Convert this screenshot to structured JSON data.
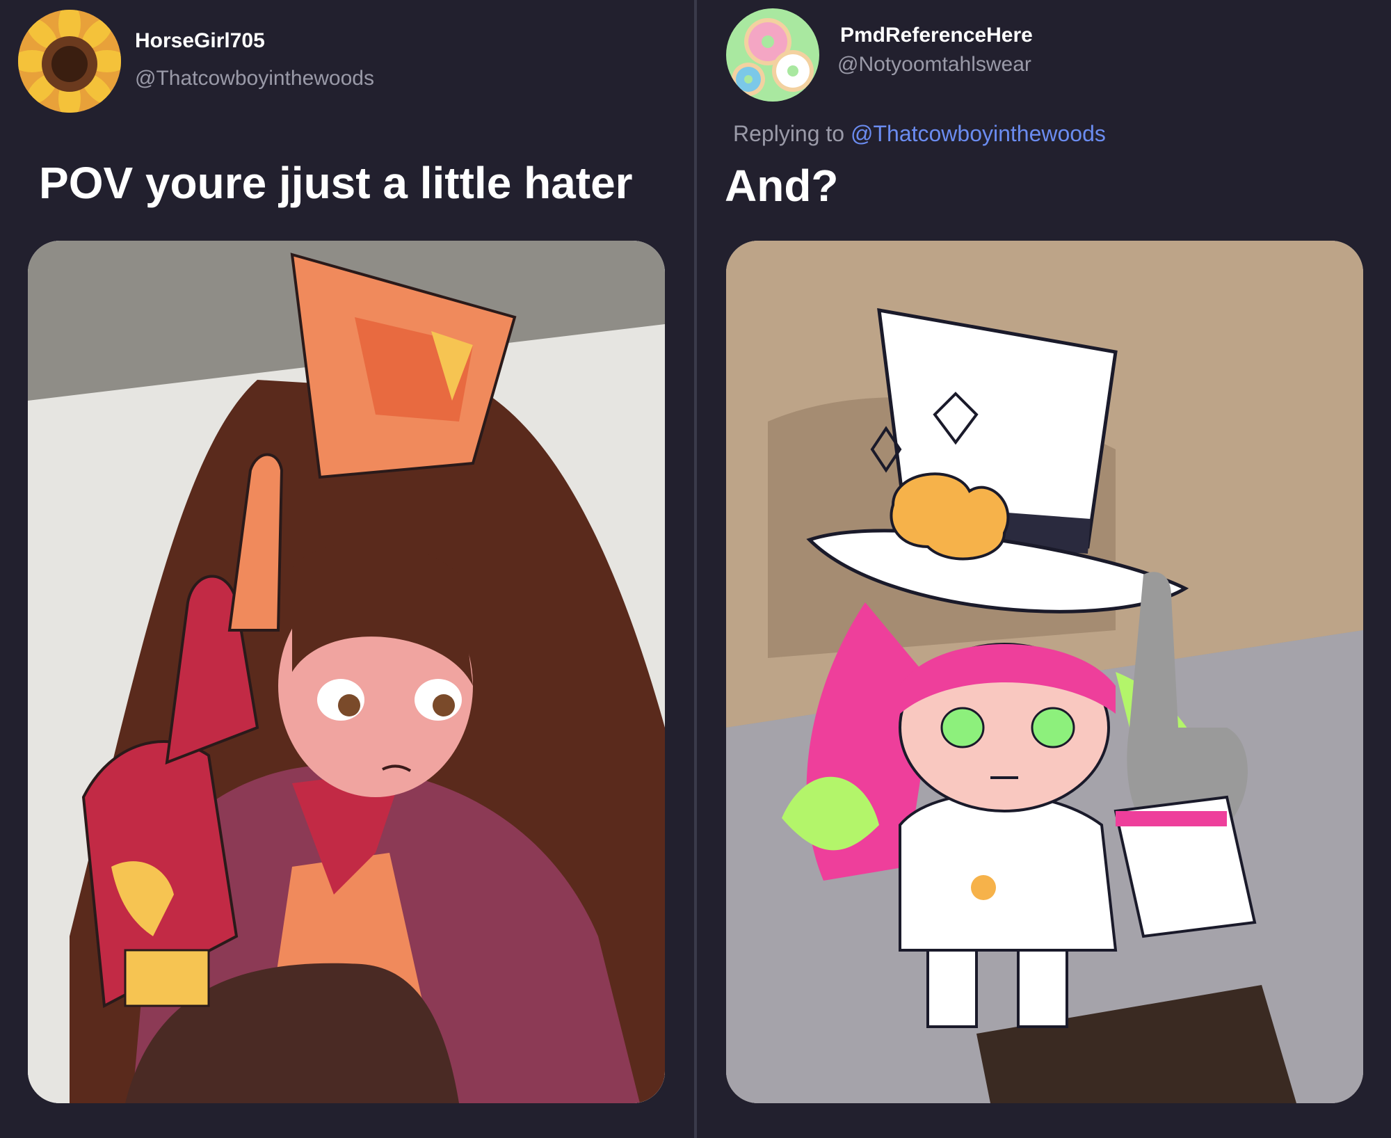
{
  "left_tweet": {
    "display_name": "HorseGirl705",
    "handle": "@Thatcowboyinthewoods",
    "text": "POV youre jjust a little hater",
    "avatar_icon": "sunflower-avatar",
    "media_icon": "cowgirl-illustration-image"
  },
  "right_tweet": {
    "display_name": "PmdReferenceHere",
    "handle": "@Notyoomtahlswear",
    "reply_prefix": "Replying to",
    "reply_to": "@Thatcowboyinthewoods",
    "text": "And?",
    "avatar_icon": "donuts-avatar",
    "media_icon": "tophat-character-photo-image"
  },
  "colors": {
    "background": "#22202e",
    "divider": "#3a3a4a",
    "link": "#6b8cf0",
    "muted_text": "#9a9aa8"
  }
}
